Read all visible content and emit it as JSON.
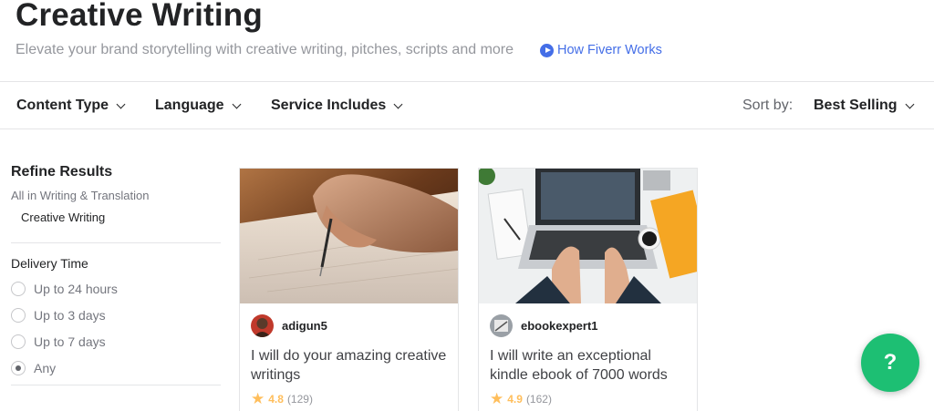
{
  "header": {
    "title": "Creative Writing",
    "subtitle": "Elevate your brand storytelling with creative writing, pitches, scripts and more",
    "how_link": "How Fiverr Works"
  },
  "filters": {
    "items": [
      {
        "label": "Content Type"
      },
      {
        "label": "Language"
      },
      {
        "label": "Service Includes"
      }
    ],
    "sort_label": "Sort by:",
    "sort_value": "Best Selling"
  },
  "sidebar": {
    "title": "Refine Results",
    "breadcrumb_parent": "All in Writing & Translation",
    "breadcrumb_current": "Creative Writing",
    "delivery_title": "Delivery Time",
    "delivery_options": [
      {
        "label": "Up to 24 hours",
        "checked": false
      },
      {
        "label": "Up to 3 days",
        "checked": false
      },
      {
        "label": "Up to 7 days",
        "checked": false
      },
      {
        "label": "Any",
        "checked": true
      }
    ]
  },
  "gigs": [
    {
      "seller": "adigun5",
      "title": "I will do your amazing creative writings",
      "rating": "4.8",
      "count": "(129)",
      "image": "hand-writing-pen-photo"
    },
    {
      "seller": "ebookexpert1",
      "title": "I will write an exceptional kindle ebook of 7000 words",
      "rating": "4.9",
      "count": "(162)",
      "image": "laptop-desk-photo"
    }
  ],
  "help": {
    "label": "?"
  },
  "colors": {
    "brand_green": "#1dbf73",
    "link_blue": "#446ee7",
    "star": "#ffbe5b"
  }
}
